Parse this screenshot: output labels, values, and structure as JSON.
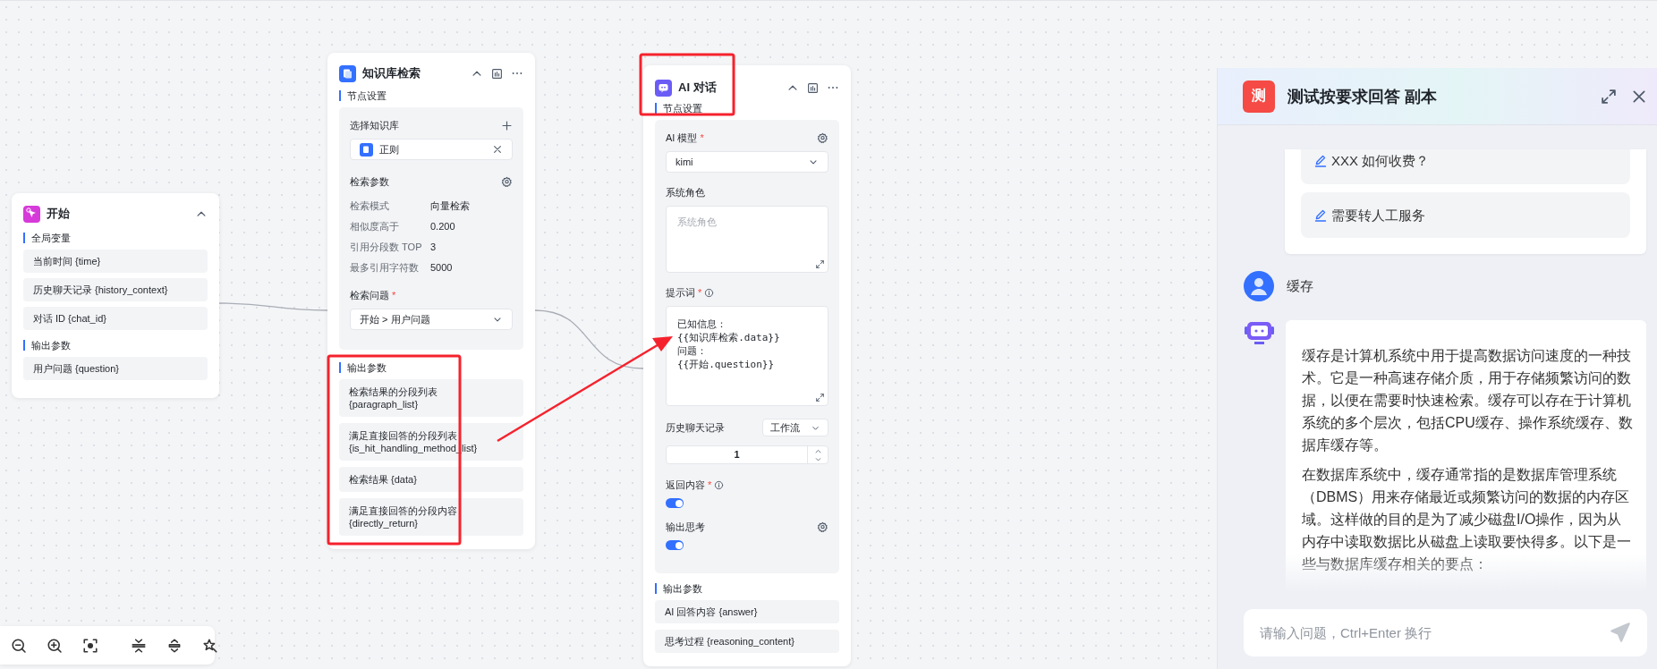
{
  "start_node": {
    "title": "开始",
    "sections": [
      {
        "title": "全局变量",
        "items": [
          "当前时间 {time}",
          "历史聊天记录 {history_context}",
          "对话 ID {chat_id}"
        ]
      },
      {
        "title": "输出参数",
        "items": [
          "用户问题 {question}"
        ]
      }
    ]
  },
  "knowledge_node": {
    "title": "知识库检索",
    "settings_title": "节点设置",
    "kb_label": "选择知识库",
    "kb_selected": "正则",
    "params_title": "检索参数",
    "params": [
      {
        "label": "检索模式",
        "value": "向量检索"
      },
      {
        "label": "相似度高于",
        "value": "0.200"
      },
      {
        "label": "引用分段数 TOP",
        "value": "3"
      },
      {
        "label": "最多引用字符数",
        "value": "5000"
      }
    ],
    "question": {
      "label": "检索问题",
      "required_mark": "*",
      "value": "开始 > 用户问题"
    },
    "output_title": "输出参数",
    "outputs": [
      "检索结果的分段列表 {paragraph_list}",
      "满足直接回答的分段列表 {is_hit_handling_method_list}",
      "检索结果 {data}",
      "满足直接回答的分段内容 {directly_return}"
    ]
  },
  "ai_node": {
    "title": "AI 对话",
    "settings_title": "节点设置",
    "model": {
      "label": "AI 模型",
      "required_mark": "*",
      "value": "kimi"
    },
    "system_role": {
      "label": "系统角色",
      "placeholder": "系统角色"
    },
    "prompt": {
      "label": "提示词",
      "required_mark": "*",
      "lines": [
        "已知信息：",
        "{{知识库检索.data}}",
        "问题：",
        "{{开始.question}}"
      ]
    },
    "history": {
      "label": "历史聊天记录",
      "mode": "工作流",
      "count": "1"
    },
    "return_content": {
      "label": "返回内容",
      "required_mark": "*",
      "on": true
    },
    "output_thinking": {
      "label": "输出思考",
      "on": true
    },
    "output_title": "输出参数",
    "outputs": [
      "AI 回答内容 {answer}",
      "思考过程 {reasoning_content}"
    ]
  },
  "chat": {
    "logo": "测",
    "title": "测试按要求回答 副本",
    "suggestions": [
      "XXX 如何收费？",
      "需要转人工服务"
    ],
    "user_message": "缓存",
    "bot_paragraphs": [
      "缓存是计算机系统中用于提高数据访问速度的一种技术。它是一种高速存储介质，用于存储频繁访问的数据，以便在需要时快速检索。缓存可以存在于计算机系统的多个层次，包括CPU缓存、操作系统缓存、数据库缓存等。",
      "在数据库系统中，缓存通常指的是数据库管理系统（DBMS）用来存储最近或频繁访问的数据的内存区域。这样做的目的是为了减少磁盘I/O操作，因为从内存中读取数据比从磁盘上读取要快得多。以下是一些与数据库缓存相关的要点："
    ],
    "input_placeholder": "请输入问题，Ctrl+Enter 换行"
  }
}
